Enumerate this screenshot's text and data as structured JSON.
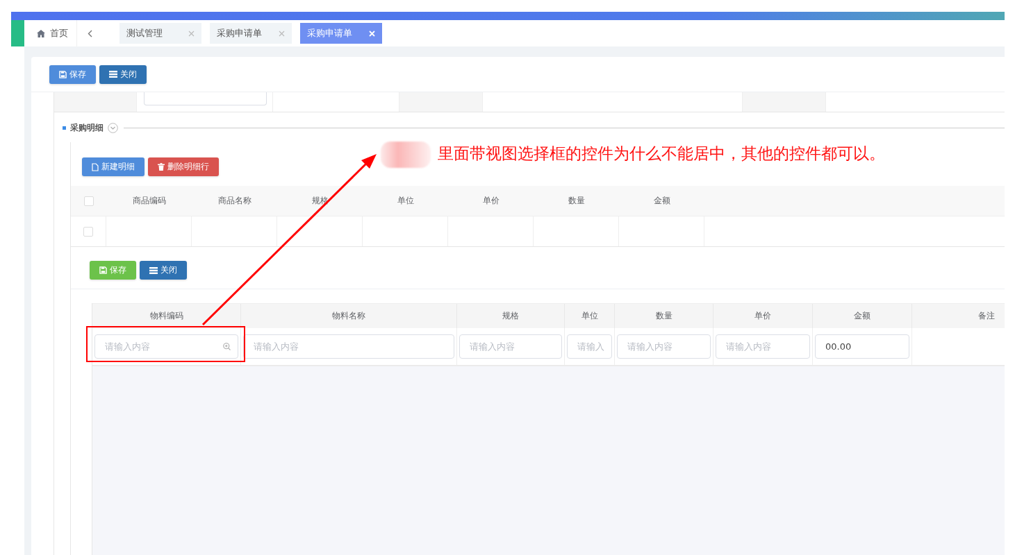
{
  "tabs": [
    {
      "label": "首页",
      "kind": "home",
      "selected": false
    },
    {
      "label": "测试管理",
      "kind": "page",
      "selected": false
    },
    {
      "label": "采购申请单",
      "kind": "page",
      "selected": false
    },
    {
      "label": "采购申请单",
      "kind": "page",
      "selected": true
    }
  ],
  "toolbar": [
    {
      "label": "保存",
      "kind": "save"
    },
    {
      "label": "关闭",
      "kind": "close"
    }
  ],
  "section": {
    "title": "采购明细",
    "expanded": true
  },
  "detail_buttons": [
    {
      "label": "新建明细",
      "kind": "new"
    },
    {
      "label": "删除明细行",
      "kind": "delete"
    }
  ],
  "detail_table": {
    "select_all_checked": false,
    "columns": [
      "商品编码",
      "商品名称",
      "规格",
      "单位",
      "单价",
      "数量",
      "金额"
    ],
    "rows": [
      {
        "checked": false
      }
    ]
  },
  "sub_toolbar": [
    {
      "label": "保存",
      "kind": "submit"
    },
    {
      "label": "关闭",
      "kind": "close"
    }
  ],
  "material_table": {
    "columns": [
      "物料编码",
      "物料名称",
      "规格",
      "单位",
      "数量",
      "单价",
      "金额",
      "备注"
    ],
    "row": [
      {
        "kind": "lookup",
        "placeholder": "请输入内容"
      },
      {
        "kind": "input",
        "placeholder": "请输入内容"
      },
      {
        "kind": "input",
        "placeholder": "请输入内容"
      },
      {
        "kind": "input",
        "placeholder": "请输入"
      },
      {
        "kind": "input",
        "placeholder": "请输入内容"
      },
      {
        "kind": "input",
        "placeholder": "请输入内容"
      },
      {
        "kind": "input",
        "value": "00.00"
      },
      {
        "kind": "blank"
      }
    ]
  },
  "annotation": {
    "text": "里面带视图选择框的控件为什么不能居中，其他的控件都可以。"
  }
}
